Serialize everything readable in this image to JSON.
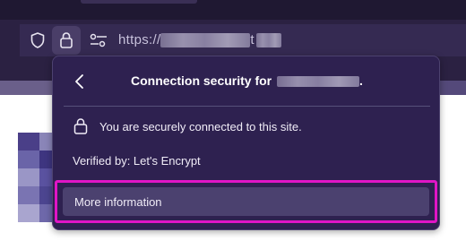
{
  "urlbar": {
    "url_prefix": "https://",
    "url_suffix": "t"
  },
  "icons": {
    "shield": "shield-icon",
    "lock": "lock-icon",
    "permissions": "permissions-sliders-icon"
  },
  "panel": {
    "title": "Connection security for",
    "title_suffix": ".",
    "secure_message": "You are securely connected to this site.",
    "verified_by": "Verified by: Let's Encrypt",
    "more_information": "More information"
  },
  "colors": {
    "panel_bg": "#2e2150",
    "highlight": "#e015c6",
    "toolbar_bg": "#2b2142"
  }
}
